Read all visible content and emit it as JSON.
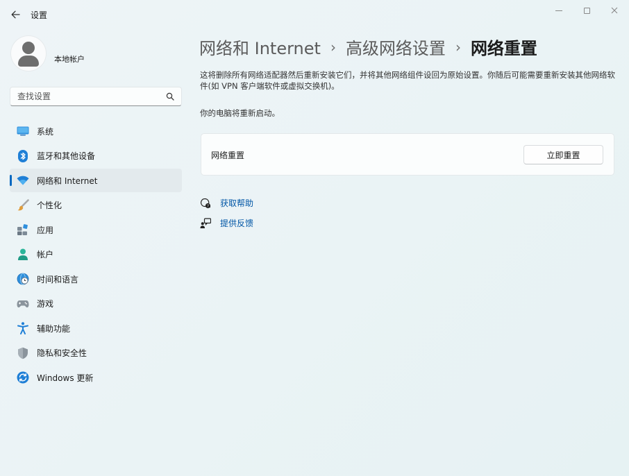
{
  "app": {
    "title": "设置"
  },
  "account": {
    "name": "本地帐户"
  },
  "search": {
    "placeholder": "查找设置"
  },
  "sidebar": {
    "items": [
      {
        "label": "系统",
        "icon": "monitor-icon"
      },
      {
        "label": "蓝牙和其他设备",
        "icon": "bluetooth-icon"
      },
      {
        "label": "网络和 Internet",
        "icon": "wifi-icon",
        "selected": true
      },
      {
        "label": "个性化",
        "icon": "brush-icon"
      },
      {
        "label": "应用",
        "icon": "apps-icon"
      },
      {
        "label": "帐户",
        "icon": "person-icon"
      },
      {
        "label": "时间和语言",
        "icon": "globe-clock-icon"
      },
      {
        "label": "游戏",
        "icon": "gamepad-icon"
      },
      {
        "label": "辅助功能",
        "icon": "accessibility-icon"
      },
      {
        "label": "隐私和安全性",
        "icon": "shield-icon"
      },
      {
        "label": "Windows 更新",
        "icon": "update-icon"
      }
    ]
  },
  "breadcrumb": {
    "items": [
      "网络和 Internet",
      "高级网络设置",
      "网络重置"
    ],
    "separator": "›"
  },
  "main": {
    "description": "这将删除所有网络适配器然后重新安装它们，并将其他网络组件设回为原始设置。你随后可能需要重新安装其他网络软件(如 VPN 客户端软件或虚拟交换机)。",
    "restart_note": "你的电脑将重新启动。",
    "card": {
      "label": "网络重置",
      "button": "立即重置"
    },
    "links": {
      "help": "获取帮助",
      "feedback": "提供反馈"
    }
  },
  "colors": {
    "accent": "#0067c0",
    "link": "#0056a6"
  }
}
